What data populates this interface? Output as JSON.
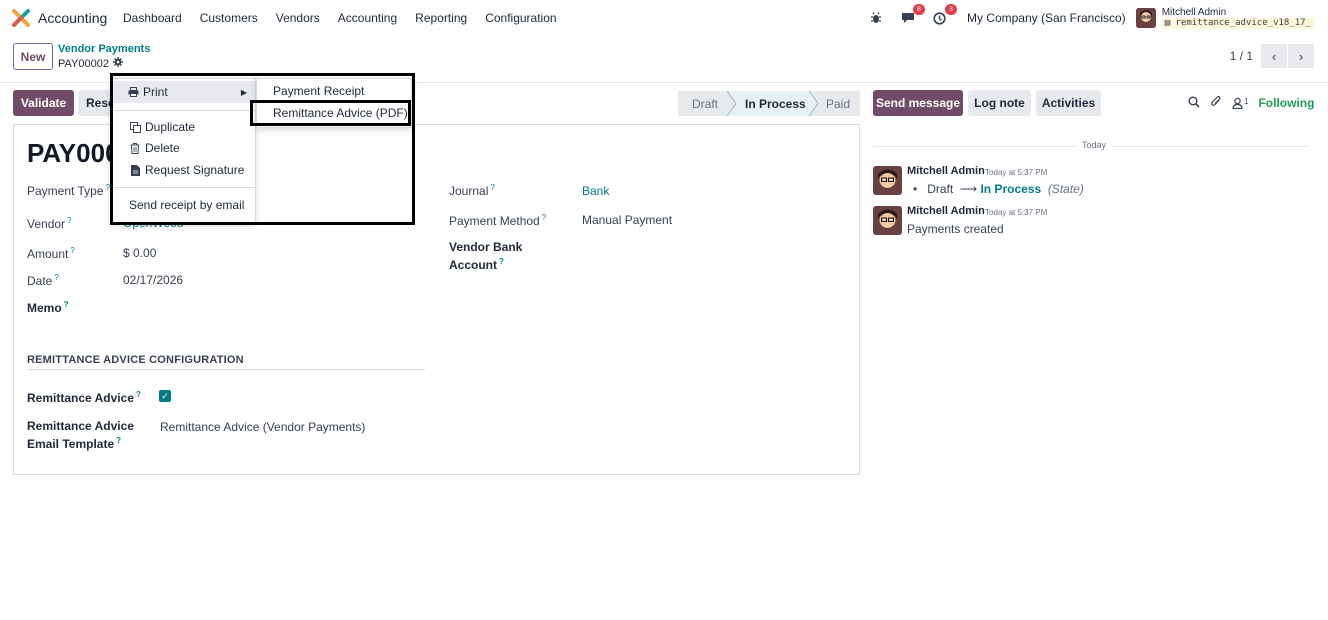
{
  "navbar": {
    "app_name": "Accounting",
    "menu": [
      "Dashboard",
      "Customers",
      "Vendors",
      "Accounting",
      "Reporting",
      "Configuration"
    ],
    "messages_badge": "8",
    "activities_badge": "3",
    "company": "My Company (San Francisco)",
    "user_name": "Mitchell Admin",
    "db_name": "remittance_advice_v18_17_"
  },
  "control": {
    "new_label": "New",
    "breadcrumb_parent": "Vendor Payments",
    "breadcrumb_current": "PAY00002",
    "pager": "1 / 1"
  },
  "actions": {
    "validate": "Validate",
    "reset": "Rese"
  },
  "status": {
    "stages": [
      "Draft",
      "In Process",
      "Paid"
    ],
    "current": "In Process"
  },
  "form": {
    "title": "PAY000",
    "payment_type_label": "Payment Type",
    "vendor_label": "Vendor",
    "vendor_value": "OpenWood",
    "amount_label": "Amount",
    "amount_value": "$ 0.00",
    "date_label": "Date",
    "date_value": "02/17/2026",
    "memo_label": "Memo",
    "journal_label": "Journal",
    "journal_value": "Bank",
    "payment_method_label": "Payment Method",
    "payment_method_value": "Manual Payment",
    "vendor_bank_label_1": "Vendor Bank",
    "vendor_bank_label_2": "Account",
    "section_title": "REMITTANCE ADVICE CONFIGURATION",
    "remittance_label": "Remittance Advice",
    "remittance_checked": true,
    "template_label_1": "Remittance Advice",
    "template_label_2": "Email Template",
    "template_value": "Remittance Advice (Vendor Payments)"
  },
  "chatter": {
    "send_message": "Send message",
    "log_note": "Log note",
    "activities": "Activities",
    "followers_count": "1",
    "following": "Following",
    "today": "Today",
    "messages": [
      {
        "author": "Mitchell Admin",
        "time": "Today at 5:37 PM",
        "from": "Draft",
        "to": "In Process",
        "field": "(State)"
      },
      {
        "author": "Mitchell Admin",
        "time": "Today at 5:37 PM",
        "body": "Payments created"
      }
    ]
  },
  "dropdown": {
    "print": "Print",
    "duplicate": "Duplicate",
    "delete": "Delete",
    "request_signature": "Request Signature",
    "send_receipt": "Send receipt by email"
  },
  "submenu": {
    "payment_receipt": "Payment Receipt",
    "remittance_pdf": "Remittance Advice (PDF)"
  },
  "colors": {
    "brand": "#714B67",
    "link": "#017e84",
    "following": "#1f9d55",
    "badge": "#e13c4b"
  }
}
